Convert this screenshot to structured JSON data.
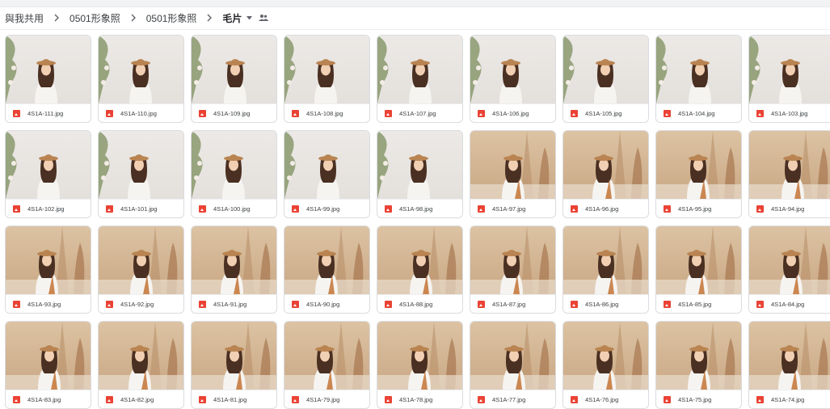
{
  "breadcrumb": {
    "items": [
      "與我共用",
      "0501形象照",
      "0501形象照"
    ],
    "current": "毛片"
  },
  "icons": {
    "separator": "chevron-right-icon",
    "dropdown": "arrow-drop-down-icon",
    "shared": "people-icon",
    "file_type": "image-file-icon"
  },
  "colors": {
    "file_icon": "#ea4335",
    "white_backdrop": "#e8e5e2",
    "beige_backdrop": "#d4b692"
  },
  "files": [
    {
      "name": "4S1A-111.jpg",
      "bg": "white"
    },
    {
      "name": "4S1A-110.jpg",
      "bg": "white"
    },
    {
      "name": "4S1A-109.jpg",
      "bg": "white"
    },
    {
      "name": "4S1A-108.jpg",
      "bg": "white"
    },
    {
      "name": "4S1A-107.jpg",
      "bg": "white"
    },
    {
      "name": "4S1A-106.jpg",
      "bg": "white"
    },
    {
      "name": "4S1A-105.jpg",
      "bg": "white"
    },
    {
      "name": "4S1A-104.jpg",
      "bg": "white"
    },
    {
      "name": "4S1A-103.jpg",
      "bg": "white"
    },
    {
      "name": "4S1A-102.jpg",
      "bg": "white"
    },
    {
      "name": "4S1A-101.jpg",
      "bg": "white"
    },
    {
      "name": "4S1A-100.jpg",
      "bg": "white"
    },
    {
      "name": "4S1A-99.jpg",
      "bg": "white"
    },
    {
      "name": "4S1A-98.jpg",
      "bg": "white"
    },
    {
      "name": "4S1A-97.jpg",
      "bg": "beige"
    },
    {
      "name": "4S1A-96.jpg",
      "bg": "beige"
    },
    {
      "name": "4S1A-95.jpg",
      "bg": "beige"
    },
    {
      "name": "4S1A-94.jpg",
      "bg": "beige"
    },
    {
      "name": "4S1A-93.jpg",
      "bg": "beige"
    },
    {
      "name": "4S1A-92.jpg",
      "bg": "beige"
    },
    {
      "name": "4S1A-91.jpg",
      "bg": "beige"
    },
    {
      "name": "4S1A-90.jpg",
      "bg": "beige"
    },
    {
      "name": "4S1A-88.jpg",
      "bg": "beige"
    },
    {
      "name": "4S1A-87.jpg",
      "bg": "beige"
    },
    {
      "name": "4S1A-86.jpg",
      "bg": "beige"
    },
    {
      "name": "4S1A-85.jpg",
      "bg": "beige"
    },
    {
      "name": "4S1A-84.jpg",
      "bg": "beige"
    },
    {
      "name": "4S1A-83.jpg",
      "bg": "beige"
    },
    {
      "name": "4S1A-82.jpg",
      "bg": "beige"
    },
    {
      "name": "4S1A-81.jpg",
      "bg": "beige"
    },
    {
      "name": "4S1A-79.jpg",
      "bg": "beige"
    },
    {
      "name": "4S1A-78.jpg",
      "bg": "beige"
    },
    {
      "name": "4S1A-77.jpg",
      "bg": "beige"
    },
    {
      "name": "4S1A-76.jpg",
      "bg": "beige"
    },
    {
      "name": "4S1A-75.jpg",
      "bg": "beige"
    },
    {
      "name": "4S1A-74.jpg",
      "bg": "beige"
    }
  ]
}
